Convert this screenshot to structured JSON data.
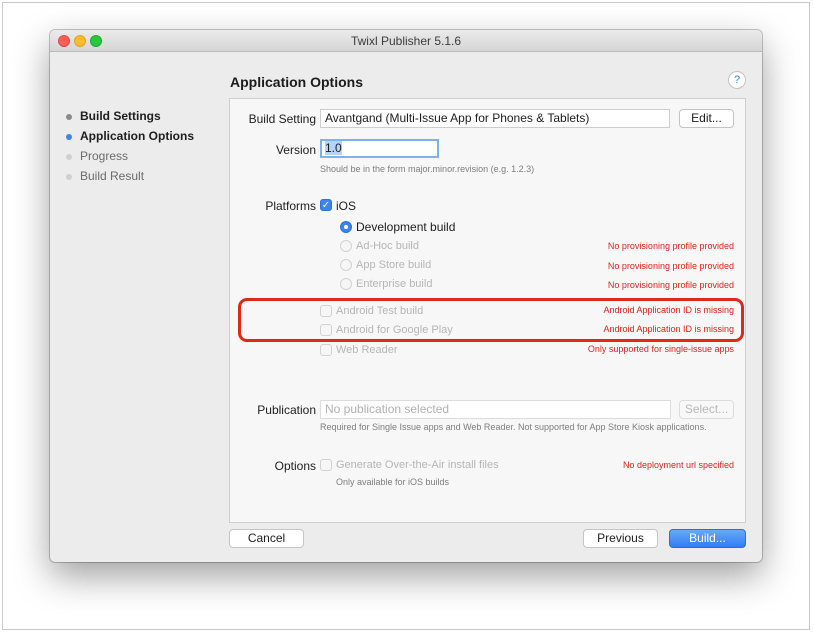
{
  "window": {
    "title": "Twixl Publisher 5.1.6"
  },
  "sidebar": {
    "items": [
      {
        "label": "Build Settings",
        "state": "done"
      },
      {
        "label": "Application Options",
        "state": "current"
      },
      {
        "label": "Progress",
        "state": "pending"
      },
      {
        "label": "Build Result",
        "state": "pending"
      }
    ]
  },
  "header": {
    "title": "Application Options",
    "help": "?"
  },
  "build_setting": {
    "label": "Build Setting",
    "value": "Avantgand (Multi-Issue App for Phones & Tablets)",
    "edit_button": "Edit..."
  },
  "version": {
    "label": "Version",
    "value": "1.0",
    "hint": "Should be in the form major.minor.revision (e.g. 1.2.3)"
  },
  "platforms": {
    "label": "Platforms",
    "ios": {
      "label": "iOS",
      "checked": true
    },
    "ios_builds": [
      {
        "label": "Development build",
        "selected": true,
        "enabled": true,
        "warning": ""
      },
      {
        "label": "Ad-Hoc build",
        "selected": false,
        "enabled": false,
        "warning": "No provisioning profile provided"
      },
      {
        "label": "App Store build",
        "selected": false,
        "enabled": false,
        "warning": "No provisioning profile provided"
      },
      {
        "label": "Enterprise build",
        "selected": false,
        "enabled": false,
        "warning": "No provisioning profile provided"
      }
    ],
    "other": [
      {
        "label": "Android Test build",
        "enabled": false,
        "warning": "Android Application ID is missing"
      },
      {
        "label": "Android for Google Play",
        "enabled": false,
        "warning": "Android Application ID is missing"
      },
      {
        "label": "Web Reader",
        "enabled": false,
        "warning": "Only supported for single-issue apps"
      }
    ]
  },
  "publication": {
    "label": "Publication",
    "placeholder": "No publication selected",
    "select_button": "Select...",
    "hint": "Required for Single Issue apps and Web Reader. Not supported for App Store Kiosk applications."
  },
  "options": {
    "label": "Options",
    "ota": {
      "label": "Generate Over-the-Air install files",
      "enabled": false,
      "warning": "No deployment url specified"
    },
    "hint": "Only available for iOS builds"
  },
  "footer": {
    "cancel": "Cancel",
    "previous": "Previous",
    "build": "Build..."
  },
  "colors": {
    "accent": "#3a85f0",
    "warning": "#e0201b",
    "highlight_box": "#dd2a17"
  }
}
